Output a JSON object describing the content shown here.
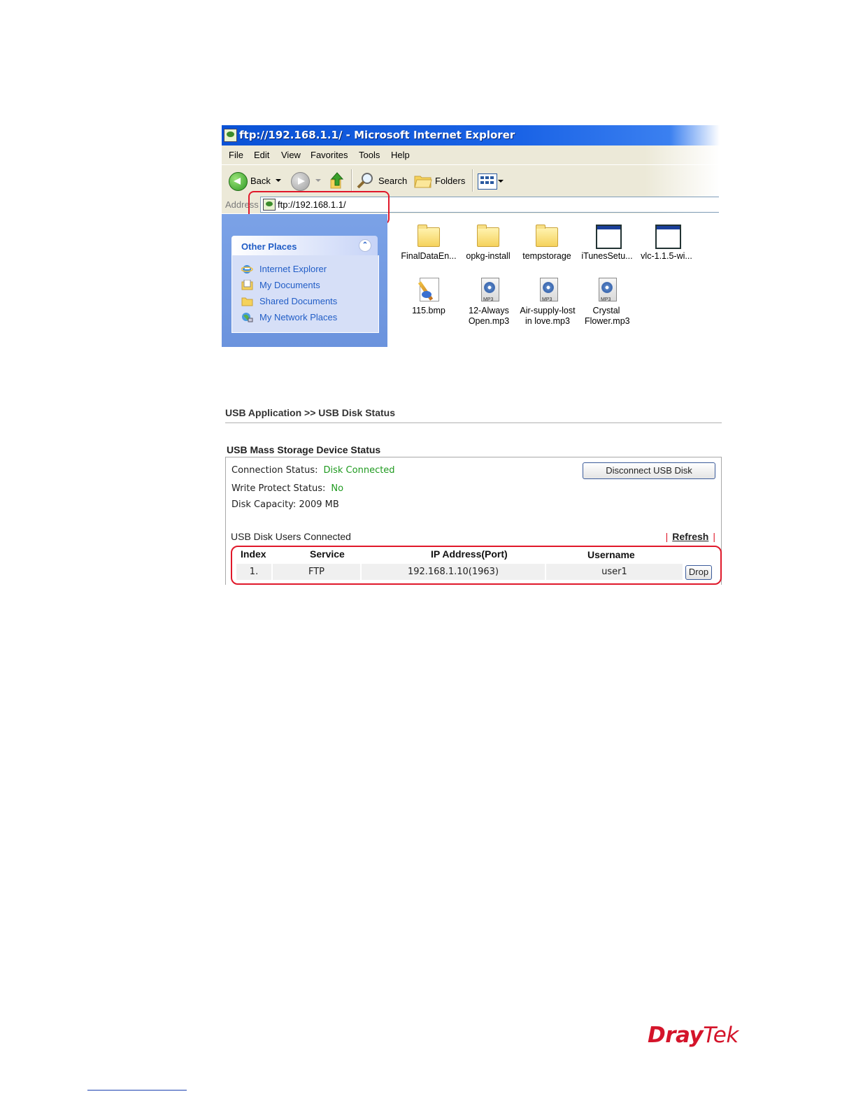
{
  "ie_window": {
    "title": "ftp://192.168.1.1/ - Microsoft Internet Explorer",
    "menu": [
      "File",
      "Edit",
      "View",
      "Favorites",
      "Tools",
      "Help"
    ],
    "toolbar": {
      "back": "Back",
      "search": "Search",
      "folders": "Folders"
    },
    "address": {
      "label": "Address",
      "value": "ftp://192.168.1.1/"
    },
    "other_places": {
      "title": "Other Places",
      "items": [
        {
          "label": "Internet Explorer",
          "icon": "ie-icon"
        },
        {
          "label": "My Documents",
          "icon": "documents-icon"
        },
        {
          "label": "Shared Documents",
          "icon": "folder-icon"
        },
        {
          "label": "My Network Places",
          "icon": "network-icon"
        }
      ]
    },
    "files": [
      {
        "name": "FinalDataEn...",
        "icon": "folder-icon"
      },
      {
        "name": "opkg-install",
        "icon": "folder-icon"
      },
      {
        "name": "tempstorage",
        "icon": "folder-icon"
      },
      {
        "name": "iTunesSetu...",
        "icon": "application-icon"
      },
      {
        "name": "vlc-1.1.5-wi...",
        "icon": "application-icon"
      },
      {
        "name": "115.bmp",
        "icon": "bitmap-icon"
      },
      {
        "name": "12-Always Open.mp3",
        "icon": "mp3-icon"
      },
      {
        "name": "Air-supply-lost in love.mp3",
        "icon": "mp3-icon"
      },
      {
        "name": "Crystal Flower.mp3",
        "icon": "mp3-icon"
      }
    ]
  },
  "usb_page": {
    "breadcrumb": "USB Application >> USB Disk Status",
    "section_title": "USB Mass Storage Device Status",
    "connection_status": {
      "label": "Connection Status:",
      "value": "Disk Connected"
    },
    "write_protect": {
      "label": "Write Protect Status:",
      "value": "No"
    },
    "disk_capacity": {
      "label": "Disk Capacity:",
      "value": "2009 MB"
    },
    "disconnect_button": "Disconnect USB Disk",
    "users_title": "USB Disk Users Connected",
    "refresh_link": "Refresh",
    "table": {
      "headers": [
        "Index",
        "Service",
        "IP Address(Port)",
        "Username"
      ],
      "rows": [
        {
          "index": "1.",
          "service": "FTP",
          "ip_port": "192.168.1.10(1963)",
          "username": "user1",
          "action": "Drop"
        }
      ]
    },
    "status_color": "#1f9a1f"
  },
  "footer": {
    "logo_dray": "Dray",
    "logo_tek": "Tek",
    "brand_color": "#d4142a"
  }
}
